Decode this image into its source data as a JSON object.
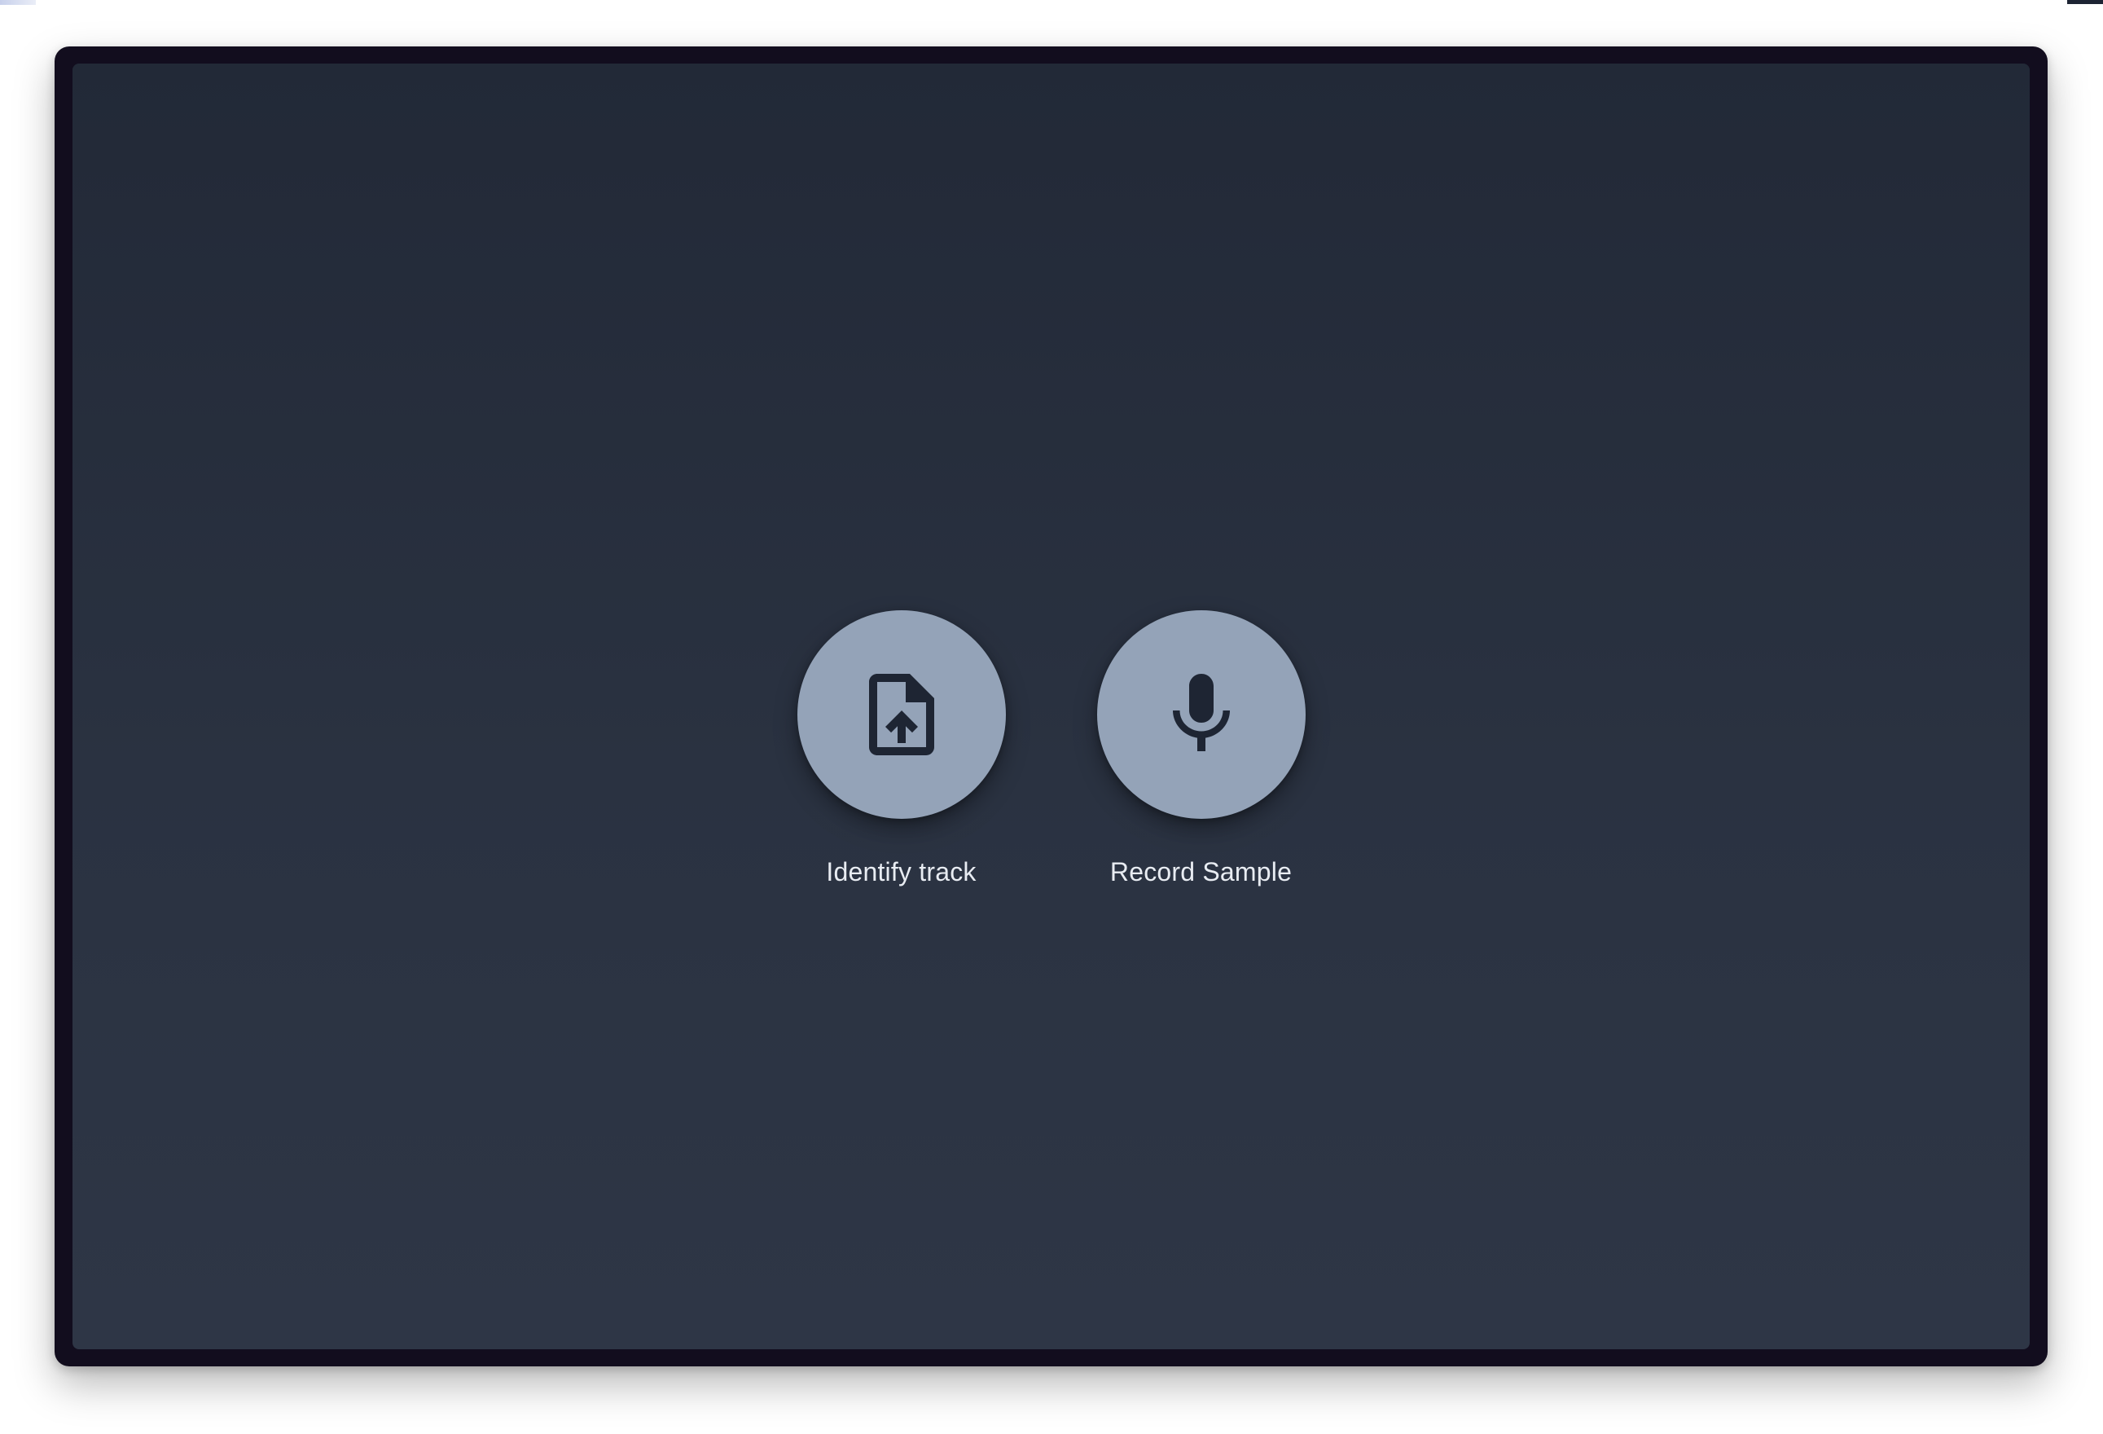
{
  "actions": {
    "identify": {
      "label": "Identify track",
      "icon": "upload-file-icon"
    },
    "record": {
      "label": "Record Sample",
      "icon": "microphone-icon"
    }
  },
  "colors": {
    "button_fill": "#94a3b8",
    "icon": "#1e2533",
    "label": "#e8ecf2",
    "screen_top": "#222937",
    "screen_bottom": "#2e3646",
    "frame": "#120d1e"
  }
}
